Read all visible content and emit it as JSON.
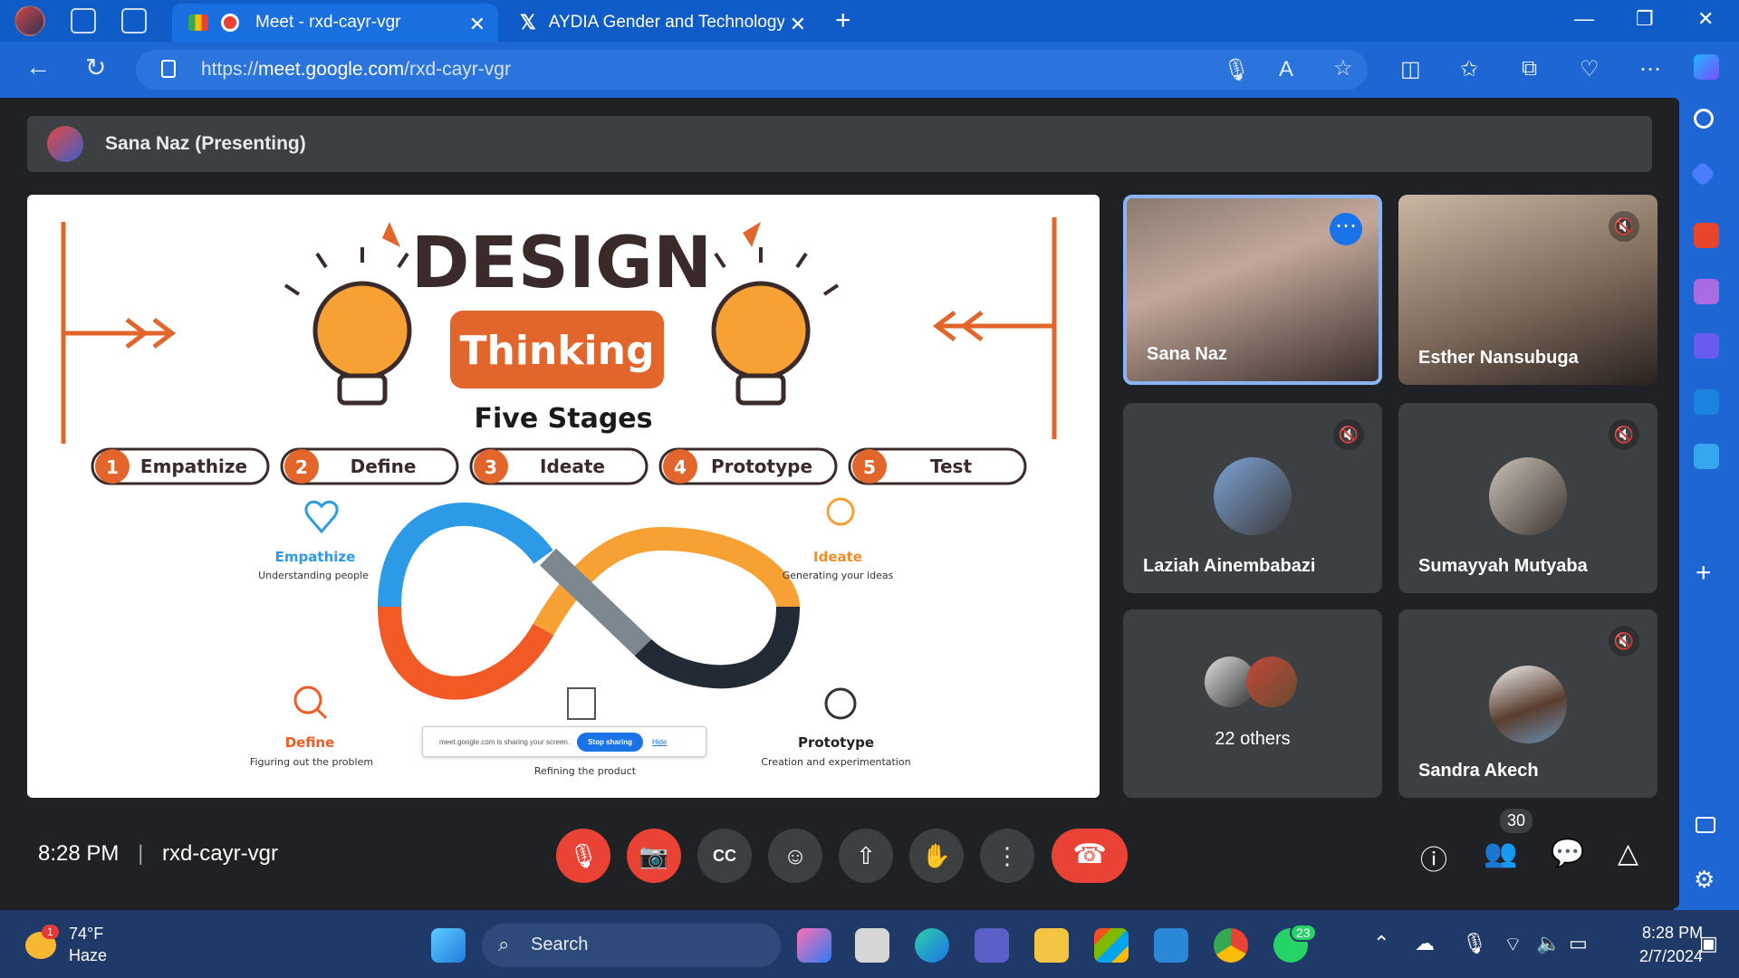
{
  "browser": {
    "tabs": [
      {
        "label": "Meet - rxd-cayr-vgr"
      },
      {
        "label": "AYDIA Gender and Technology In"
      }
    ],
    "url_prefix": "https://",
    "url_host": "meet.google.com",
    "url_path": "/rxd-cayr-vgr"
  },
  "meet": {
    "presenting_banner": "Sana Naz (Presenting)",
    "time": "8:28 PM",
    "meeting_code": "rxd-cayr-vgr",
    "participant_count": "30",
    "tiles": [
      {
        "name": "Sana Naz"
      },
      {
        "name": "Esther Nansubuga"
      },
      {
        "name": "Laziah Ainembabazi"
      },
      {
        "name": "Sumayyah Mutyaba"
      },
      {
        "name": "22 others"
      },
      {
        "name": "Sandra Akech"
      }
    ]
  },
  "slide": {
    "title": "DESIGN",
    "subtitle": "Thinking",
    "heading": "Five Stages",
    "stages": [
      {
        "num": "1",
        "label": "Empathize"
      },
      {
        "num": "2",
        "label": "Define"
      },
      {
        "num": "3",
        "label": "Ideate"
      },
      {
        "num": "4",
        "label": "Prototype"
      },
      {
        "num": "5",
        "label": "Test"
      }
    ],
    "notes": [
      {
        "title": "Empathize",
        "desc": "Understanding people",
        "color": "#2c9ae6"
      },
      {
        "title": "Ideate",
        "desc": "Generating your ideas",
        "color": "#f28c28"
      },
      {
        "title": "Define",
        "desc": "Figuring out the problem",
        "color": "#f15a24"
      },
      {
        "title": "",
        "desc": "Refining the product",
        "color": "#333333"
      },
      {
        "title": "Prototype",
        "desc": "Creation and experimentation",
        "color": "#333333"
      }
    ],
    "share_notice": "meet.google.com is sharing your screen.",
    "stop_label": "Stop sharing",
    "hide_label": "Hide"
  },
  "taskbar": {
    "weather_temp": "74°F",
    "weather_desc": "Haze",
    "weather_badge": "1",
    "search_label": "Search",
    "whatsapp_badge": "23",
    "clock_time": "8:28 PM",
    "clock_date": "2/7/2024"
  },
  "colors": {
    "accent_blue": "#0f5cc8",
    "meet_red": "#ea4335",
    "slide_orange": "#e2662b"
  }
}
